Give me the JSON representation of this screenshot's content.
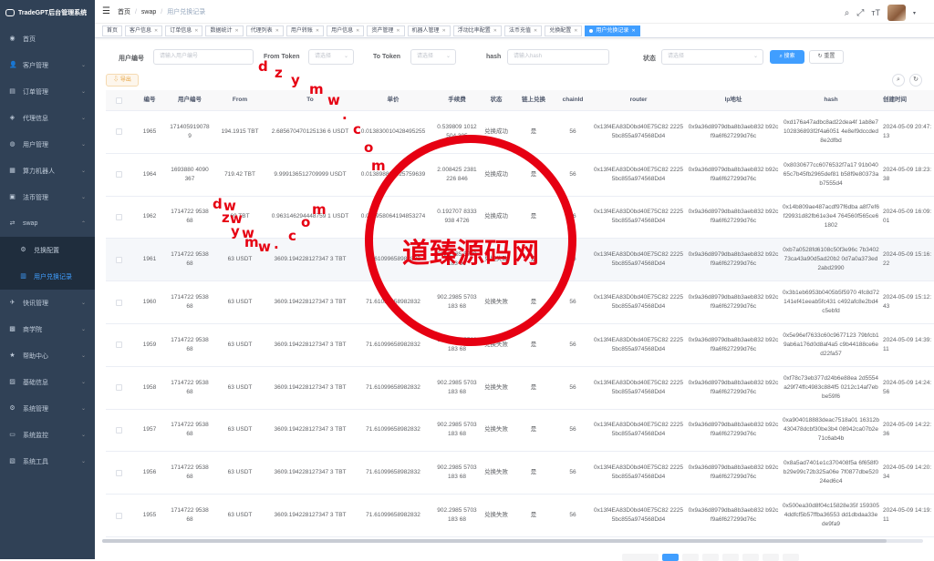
{
  "app": {
    "title": "TradeGPT后台管理系统"
  },
  "sidebar": {
    "items": [
      {
        "label": "首页",
        "icon": "dashboard-icon",
        "expanded": false
      },
      {
        "label": "客户管理",
        "icon": "user-icon",
        "expanded": false
      },
      {
        "label": "订单管理",
        "icon": "order-icon",
        "expanded": false
      },
      {
        "label": "代理信息",
        "icon": "agent-icon",
        "expanded": false
      },
      {
        "label": "用户管理",
        "icon": "users-icon",
        "expanded": false
      },
      {
        "label": "算力机器人",
        "icon": "robot-icon",
        "expanded": false
      },
      {
        "label": "法币管理",
        "icon": "money-icon",
        "expanded": false
      },
      {
        "label": "swap",
        "icon": "swap-icon",
        "expanded": true
      },
      {
        "label": "兑换配置",
        "icon": "config-icon",
        "sub": true
      },
      {
        "label": "用户兑换记录",
        "icon": "record-icon",
        "sub": true,
        "active": true
      },
      {
        "label": "快讯管理",
        "icon": "news-icon",
        "expanded": false
      },
      {
        "label": "商学院",
        "icon": "school-icon",
        "expanded": false
      },
      {
        "label": "帮助中心",
        "icon": "help-icon",
        "expanded": false
      },
      {
        "label": "基础信息",
        "icon": "info-icon",
        "expanded": false
      },
      {
        "label": "系统管理",
        "icon": "gear-icon",
        "expanded": false
      },
      {
        "label": "系统监控",
        "icon": "monitor-icon",
        "expanded": false
      },
      {
        "label": "系统工具",
        "icon": "tool-icon",
        "expanded": false
      }
    ]
  },
  "breadcrumb": {
    "home": "首页",
    "parent": "swap",
    "current": "用户兑换记录"
  },
  "tabs": [
    "首页",
    "客户信息",
    "订单信息",
    "数据统计",
    "代理列表",
    "用户转账",
    "用户信息",
    "资产管理",
    "机器人管理",
    "浮动比率配置",
    "法币充值",
    "兑换配置",
    "用户兑换记录"
  ],
  "filters": {
    "user_id_label": "用户编号",
    "user_id_placeholder": "请输入用户编号",
    "from_token_label": "From Token",
    "from_token_placeholder": "请选择",
    "to_token_label": "To Token",
    "to_token_placeholder": "请选择",
    "hash_label": "hash",
    "hash_placeholder": "请输入hash",
    "status_label": "状态",
    "status_placeholder": "请选择",
    "search_label": "搜索",
    "reset_label": "重置"
  },
  "toolbar": {
    "export_label": "导出"
  },
  "table": {
    "headers": [
      "",
      "编号",
      "用户编号",
      "From",
      "To",
      "单价",
      "手续费",
      "状态",
      "链上兑换",
      "chainId",
      "router",
      "lp地址",
      "hash",
      "创建时间"
    ],
    "rows": [
      {
        "id": "1965",
        "user": "1714059190789",
        "from": "194.1915 TBT",
        "to": "2.685670470125136 6 USDT",
        "price": "0.013830010428495255",
        "fee": "0.539809 1012504 305",
        "status": "兑换成功",
        "onchain": "是",
        "chain": "56",
        "router": "0x13f4EA83D0bd40E75C82 22255bc855a974568Dd4",
        "lp": "0x9a36d8979dba8b3aeb832 b92cf9a6f627299d76c",
        "hash": "0xd176a47adbc8ad22dea4f 1ab8e7102836893f2f4a6051 4e8ef9dccded8e2dfbd",
        "time": "2024-05-09 20:47:13"
      },
      {
        "id": "1964",
        "user": "1693880 4090367",
        "from": "719.42 TBT",
        "to": "9.999136512709999 USDT",
        "price": "0.013898885925759639",
        "fee": "2.008425 2381226 846",
        "status": "兑换成功",
        "onchain": "是",
        "chain": "56",
        "router": "0x13f4EA83D0bd40E75C82 22255bc855a974568Dd4",
        "lp": "0x9a36d8979dba8b3aeb832 b92cf9a6f627299d76c",
        "hash": "0x8030677cc6076532f7a17 91b04065c7b45fb2965def81 b58f9e80373ab7555d4",
        "time": "2024-05-09 18:23:38"
      },
      {
        "id": "1962",
        "user": "1714722 953868",
        "from": "69 TBT",
        "to": "0.963146294448759 1 USDT",
        "price": "0.013958064194853274",
        "fee": "0.192707 8333938 4726",
        "status": "兑换成功",
        "onchain": "是",
        "chain": "56",
        "router": "0x13f4EA83D0bd40E75C82 22255bc855a974568Dd4",
        "lp": "0x9a36d8979dba8b3aeb832 b92cf9a6f627299d76c",
        "hash": "0x14b809ae487acdf97f6dba a8f7ef6f29931d82fb61e3e4 764560f565ce61802",
        "time": "2024-05-09 16:09:01"
      },
      {
        "id": "1961",
        "user": "1714722 953868",
        "from": "63 USDT",
        "to": "3609.194228127347 3 TBT",
        "price": "71.61099658982832",
        "fee": "902.2985 5703183 68",
        "status": "兑换失败",
        "onchain": "是",
        "chain": "56",
        "router": "0x13f4EA83D0bd40E75C82 22255bc855a974568Dd4",
        "lp": "0x9a36d8979dba8b3aeb832 b92cf9a6f627299d76c",
        "hash": "0xb7a0528fd6108c50f3e96c 7b340273ca43a90d5ad20b2 0d7a0a373ed2abd2990",
        "time": "2024-05-09 15:16:22"
      },
      {
        "id": "1960",
        "user": "1714722 953868",
        "from": "63 USDT",
        "to": "3609.194228127347 3 TBT",
        "price": "71.61099658982832",
        "fee": "902.2985 5703183 68",
        "status": "兑换失败",
        "onchain": "是",
        "chain": "56",
        "router": "0x13f4EA83D0bd40E75C82 22255bc855a974568Dd4",
        "lp": "0x9a36d8979dba8b3aeb832 b92cf9a6f627299d76c",
        "hash": "0x3b1eb6953b0405b5f5970 4fc8d72141ef41eeab5fc431 c492afc8e2bd4c5ebfd",
        "time": "2024-05-09 15:12:43"
      },
      {
        "id": "1959",
        "user": "1714722 953868",
        "from": "63 USDT",
        "to": "3609.194228127347 3 TBT",
        "price": "71.61099658982832",
        "fee": "902.2985 5703183 68",
        "status": "兑换失败",
        "onchain": "是",
        "chain": "56",
        "router": "0x13f4EA83D0bd40E75C82 22255bc855a974568Dd4",
        "lp": "0x9a36d8979dba8b3aeb832 b92cf9a6f627299d76c",
        "hash": "0x5e96ef7633c60c9677123 79bfcb19ab6a176d0d8af4a5 c9b44188ce6ed22fa57",
        "time": "2024-05-09 14:39:11"
      },
      {
        "id": "1958",
        "user": "1714722 953868",
        "from": "63 USDT",
        "to": "3609.194228127347 3 TBT",
        "price": "71.61099658982832",
        "fee": "902.2985 5703183 68",
        "status": "兑换失败",
        "onchain": "是",
        "chain": "56",
        "router": "0x13f4EA83D0bd40E75C82 22255bc855a974568Dd4",
        "lp": "0x9a36d8979dba8b3aeb832 b92cf9a6f627299d76c",
        "hash": "0xf78c73eb377d24b6e88ea 2d5554a29f74ffc4983c884f5 0212c14af7ebbe59f6",
        "time": "2024-05-09 14:24:56"
      },
      {
        "id": "1957",
        "user": "1714722 953868",
        "from": "63 USDT",
        "to": "3609.194228127347 3 TBT",
        "price": "71.61099658982832",
        "fee": "902.2985 5703183 68",
        "status": "兑换失败",
        "onchain": "是",
        "chain": "56",
        "router": "0x13f4EA83D0bd40E75C82 22255bc855a974568Dd4",
        "lp": "0x9a36d8979dba8b3aeb832 b92cf9a6f627299d76c",
        "hash": "0xa904018883deac7518a01 16312b430478dcbf30be3b4 08942ca07b2e71c6ab4b",
        "time": "2024-05-09 14:22:36"
      },
      {
        "id": "1956",
        "user": "1714722 953868",
        "from": "63 USDT",
        "to": "3609.194228127347 3 TBT",
        "price": "71.61099658982832",
        "fee": "902.2985 5703183 68",
        "status": "兑换失败",
        "onchain": "是",
        "chain": "56",
        "router": "0x13f4EA83D0bd40E75C82 22255bc855a974568Dd4",
        "lp": "0x9a36d8979dba8b3aeb832 b92cf9a6f627299d76c",
        "hash": "0x8a5ad7401e1c370408f5a 6f658f0b29e99c72b325a06e 7f0877dbe52024ed6c4",
        "time": "2024-05-09 14:20:34"
      },
      {
        "id": "1955",
        "user": "1714722 953868",
        "from": "63 USDT",
        "to": "3609.194228127347 3 TBT",
        "price": "71.61099658982832",
        "fee": "902.2985 5703183 68",
        "status": "兑换失败",
        "onchain": "是",
        "chain": "56",
        "router": "0x13f4EA83D0bd40E75C82 22255bc855a974568Dd4",
        "lp": "0x9a36d8979dba8b3aeb832 b92cf9a6f627299d76c",
        "hash": "0x500ea30d8f04c15828e35f 1593054ddfcf5b57ffba36553 dd1dbdaa33ede9fa9",
        "time": "2024-05-09 14:19:11"
      }
    ]
  },
  "watermark": {
    "text": "道臻源码网",
    "url_chars": [
      "d",
      "z",
      "y",
      "m",
      "w",
      ".",
      "c",
      "o",
      "m"
    ]
  }
}
